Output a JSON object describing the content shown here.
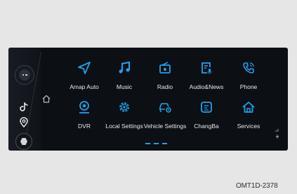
{
  "apps": [
    {
      "label": "Amap Auto",
      "icon": "navigation-arrow-icon"
    },
    {
      "label": "Music",
      "icon": "music-note-icon"
    },
    {
      "label": "Radio",
      "icon": "radio-icon"
    },
    {
      "label": "Audio&News",
      "icon": "audio-news-icon"
    },
    {
      "label": "Phone",
      "icon": "phone-icon"
    },
    {
      "label": "DVR",
      "icon": "dvr-camera-icon"
    },
    {
      "label": "Local Settings",
      "icon": "gear-icon"
    },
    {
      "label": "Vehicle Settings",
      "icon": "car-settings-icon"
    },
    {
      "label": "ChangBa",
      "icon": "changba-icon"
    },
    {
      "label": "Services",
      "icon": "services-house-icon"
    }
  ],
  "figure_code": "OMT1D-2378",
  "colors": {
    "accent": "#1da4f0",
    "label": "#e8eaed",
    "background": "#0c0f14"
  }
}
